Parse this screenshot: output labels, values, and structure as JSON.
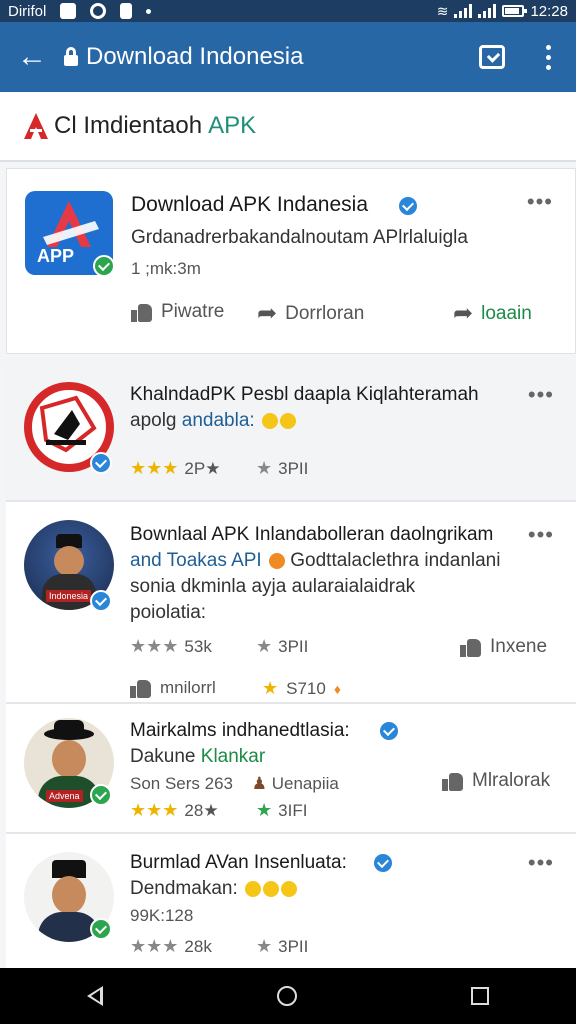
{
  "status_bar": {
    "carrier": "Dirifol",
    "time": "12:28"
  },
  "toolbar": {
    "title": "Download Indonesia"
  },
  "brand": {
    "text": "Cl Imdientaoh",
    "accent": "APK"
  },
  "posts": [
    {
      "avatar_label": "APP",
      "name": "Download APK Indanesia",
      "line1": "Grdanadrerbakandalnoutam APlrlaluigla",
      "line2": "1 ;mk:3m",
      "actions": [
        "Piwatre",
        "Dorrloran",
        "loaain"
      ]
    },
    {
      "name": "KhalndadPK Pesbl daapla Kiqlahteramah",
      "line1": "apolg",
      "line1_accent": "andabla:",
      "stats": [
        "2P★",
        "3PII"
      ]
    },
    {
      "name": "Bownlaal APK Inlandabolleran daolngrikam",
      "line1_accent": "and Toakas API",
      "line1": "Godttalaclethra indanlani",
      "line2": "sonia dkminla ayja aularaialaidrak",
      "line3": "poiolatia:",
      "stats": [
        "53k",
        "3PII"
      ],
      "actions": [
        "Inxene",
        "mnilorrl",
        "S710"
      ],
      "avatar_caption": "Indonesia"
    },
    {
      "name": "Mairkalms indhanedtlasia:",
      "line1": "Dakune",
      "line1_accent": "Klankar",
      "line2": "Son Sers 263",
      "line2b": "Uenapiia",
      "stats": [
        "28★",
        "3IFI"
      ],
      "actions": [
        "Mlralorak"
      ],
      "avatar_caption": "Advena"
    },
    {
      "name": "Burmlad AVan Insenluata:",
      "line1": "Dendmakan:",
      "line2": "99K:128",
      "stats": [
        "28k",
        "3PII"
      ]
    }
  ],
  "colors": {
    "status_bar": "#1e3d63",
    "toolbar": "#2767a6",
    "verified_blue": "#2a86d8",
    "verified_green": "#2da44e",
    "accent_green": "#1f8f7a"
  }
}
